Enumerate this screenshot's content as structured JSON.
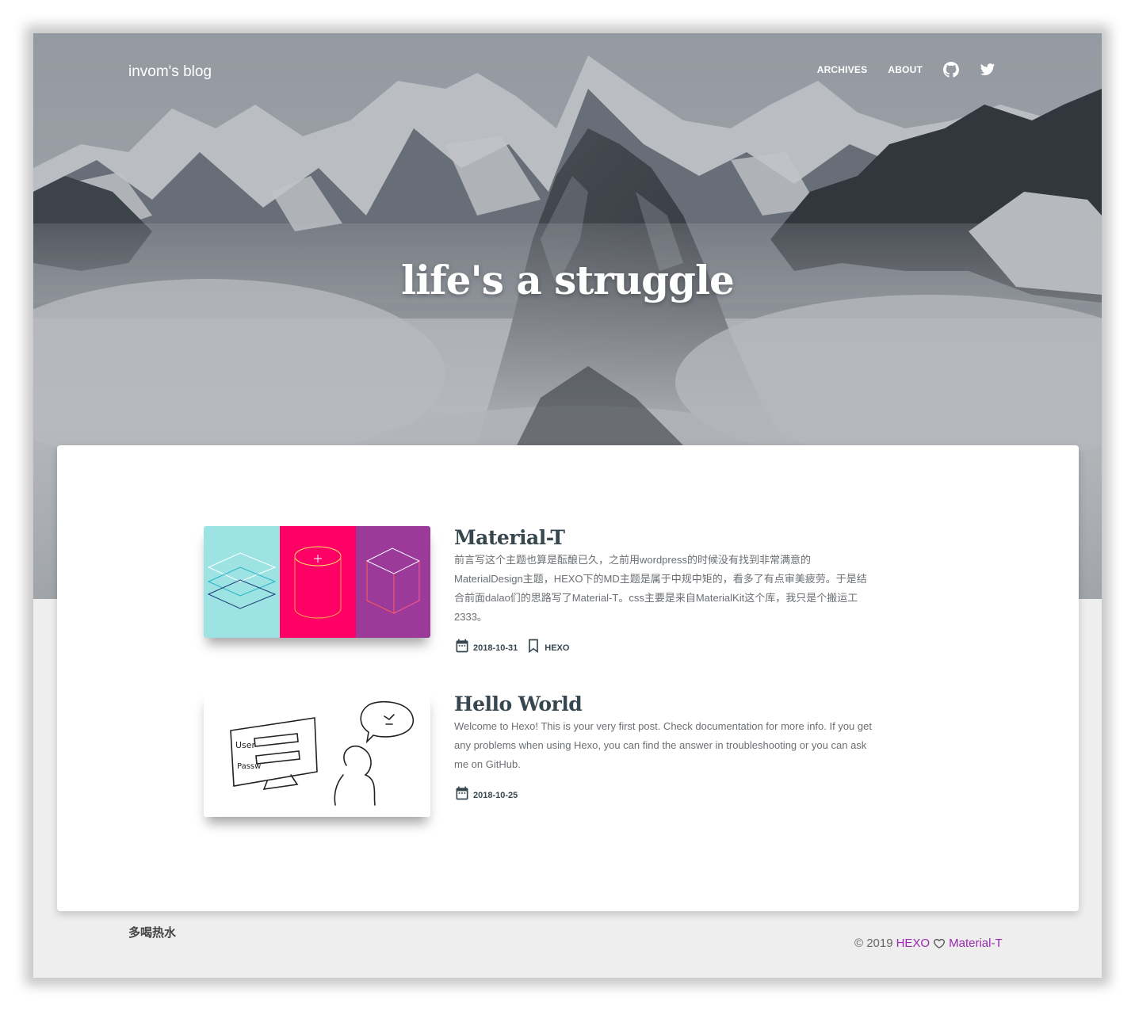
{
  "header": {
    "brand": "invom's blog",
    "nav": [
      {
        "label": "ARCHIVES"
      },
      {
        "label": "ABOUT"
      }
    ],
    "icons": [
      "github-icon",
      "twitter-icon"
    ]
  },
  "hero": {
    "title": "life's a struggle"
  },
  "posts": [
    {
      "title": "Material-T",
      "excerpt": "前言写这个主题也算是酝酿已久，之前用wordpress的时候没有找到非常满意的MaterialDesign主题，HEXO下的MD主题是属于中规中矩的，看多了有点审美疲劳。于是结合前面dalao们的思路写了Material-T。css主要是来自MaterialKit这个库，我只是个搬运工2333。",
      "date": "2018-10-31",
      "tag": "HEXO",
      "thumb_colors": [
        "#9de3e3",
        "#ff0066",
        "#9b3a99"
      ]
    },
    {
      "title": "Hello World",
      "excerpt": "Welcome to Hexo! This is your very first post. Check documentation for more info. If you get any problems when using Hexo, you can find the answer in troubleshooting or you can ask me on GitHub.",
      "date": "2018-10-25",
      "sketch_labels": [
        "User",
        "Passw"
      ]
    }
  ],
  "footer": {
    "left": "多喝热水",
    "copyright": "© 2019",
    "link1": "HEXO",
    "link2": "Material-T",
    "link_color": "#9c27b0"
  }
}
